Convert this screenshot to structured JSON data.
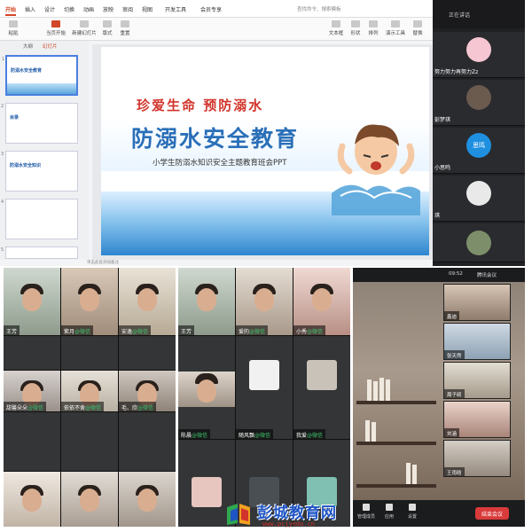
{
  "presentation": {
    "menu": [
      "开始",
      "插入",
      "设计",
      "切换",
      "动画",
      "放映",
      "审阅",
      "视图",
      "开发工具",
      "会员专享"
    ],
    "active_menu": "开始",
    "search_placeholder": "查找命令、搜索模板",
    "toolbar": [
      "粘贴",
      "当页开始",
      "新建幻灯片",
      "版式",
      "重置",
      "文本框",
      "形状",
      "排列",
      "演示工具",
      "替换"
    ],
    "pane_tabs": [
      "大纲",
      "幻灯片"
    ],
    "thumbnails": [
      {
        "num": "1",
        "title": "防溺水安全教育"
      },
      {
        "num": "2",
        "title": "目录"
      },
      {
        "num": "3",
        "title": "防溺水安全知识"
      },
      {
        "num": "4",
        "title": ""
      },
      {
        "num": "5",
        "title": ""
      }
    ],
    "slide": {
      "subtitle": "珍爱生命 预防溺水",
      "title": "防溺水安全教育",
      "caption": "小学生防溺水知识安全主题教育班会PPT"
    },
    "notes_placeholder": "单击此处添加备注"
  },
  "participant_strip": {
    "header": "正在讲话",
    "participants": [
      {
        "name": "努力努力再努力Zz",
        "color": "#f6c6d2"
      },
      {
        "name": "彭梦琪",
        "color": "#6b5a4e"
      },
      {
        "name": "思鸣",
        "color": "#1f8fe0"
      },
      {
        "name": "小思鸣",
        "color": "#e9e9e9"
      },
      {
        "name": "琪",
        "color": "#7d8f6a"
      }
    ]
  },
  "grid_left": {
    "tiles": [
      {
        "name": "王芳",
        "wechat": false
      },
      {
        "name": "紫月",
        "wechat": true
      },
      {
        "name": "安逸",
        "wechat": true
      },
      {
        "name": "",
        "wechat": false
      },
      {
        "name": "",
        "wechat": false
      },
      {
        "name": "",
        "wechat": false
      },
      {
        "name": "甜馨朵朵",
        "wechat": true
      },
      {
        "name": "依依不舍",
        "wechat": true
      },
      {
        "name": "毛、欣",
        "wechat": true
      },
      {
        "name": "",
        "wechat": false
      },
      {
        "name": "",
        "wechat": false
      },
      {
        "name": "",
        "wechat": false
      }
    ],
    "wechat_tag": "@微信"
  },
  "grid_mid": {
    "tiles": [
      {
        "name": "王芳",
        "wechat": false
      },
      {
        "name": "爱的",
        "wechat": true
      },
      {
        "name": "小秀",
        "wechat": true
      },
      {
        "name": "陈晨",
        "wechat": true
      },
      {
        "name": "随风飘",
        "wechat": true
      },
      {
        "name": "我爱",
        "wechat": true
      },
      {
        "name": "",
        "wechat": false
      },
      {
        "name": "",
        "wechat": false
      },
      {
        "name": "",
        "wechat": false
      }
    ],
    "wechat_tag": "@微信"
  },
  "phone": {
    "time": "09:52",
    "title": "腾讯会议",
    "tiles": [
      {
        "name": "鑫迪"
      },
      {
        "name": "张天然"
      },
      {
        "name": "周子硕"
      },
      {
        "name": "刘涵"
      },
      {
        "name": "王雨晗"
      }
    ],
    "bottom_buttons": [
      "管理成员",
      "应用",
      "设置"
    ],
    "end_button": "结束会议"
  },
  "watermark": {
    "brand": "彭城教育网",
    "url": "www.pcjyedu.cn"
  },
  "colors": {
    "accent": "#d24726",
    "title_blue": "#2a6fb8",
    "subtitle_red": "#d2342b",
    "wechat_green": "#3fc46f",
    "end_red": "#d93a3a"
  }
}
